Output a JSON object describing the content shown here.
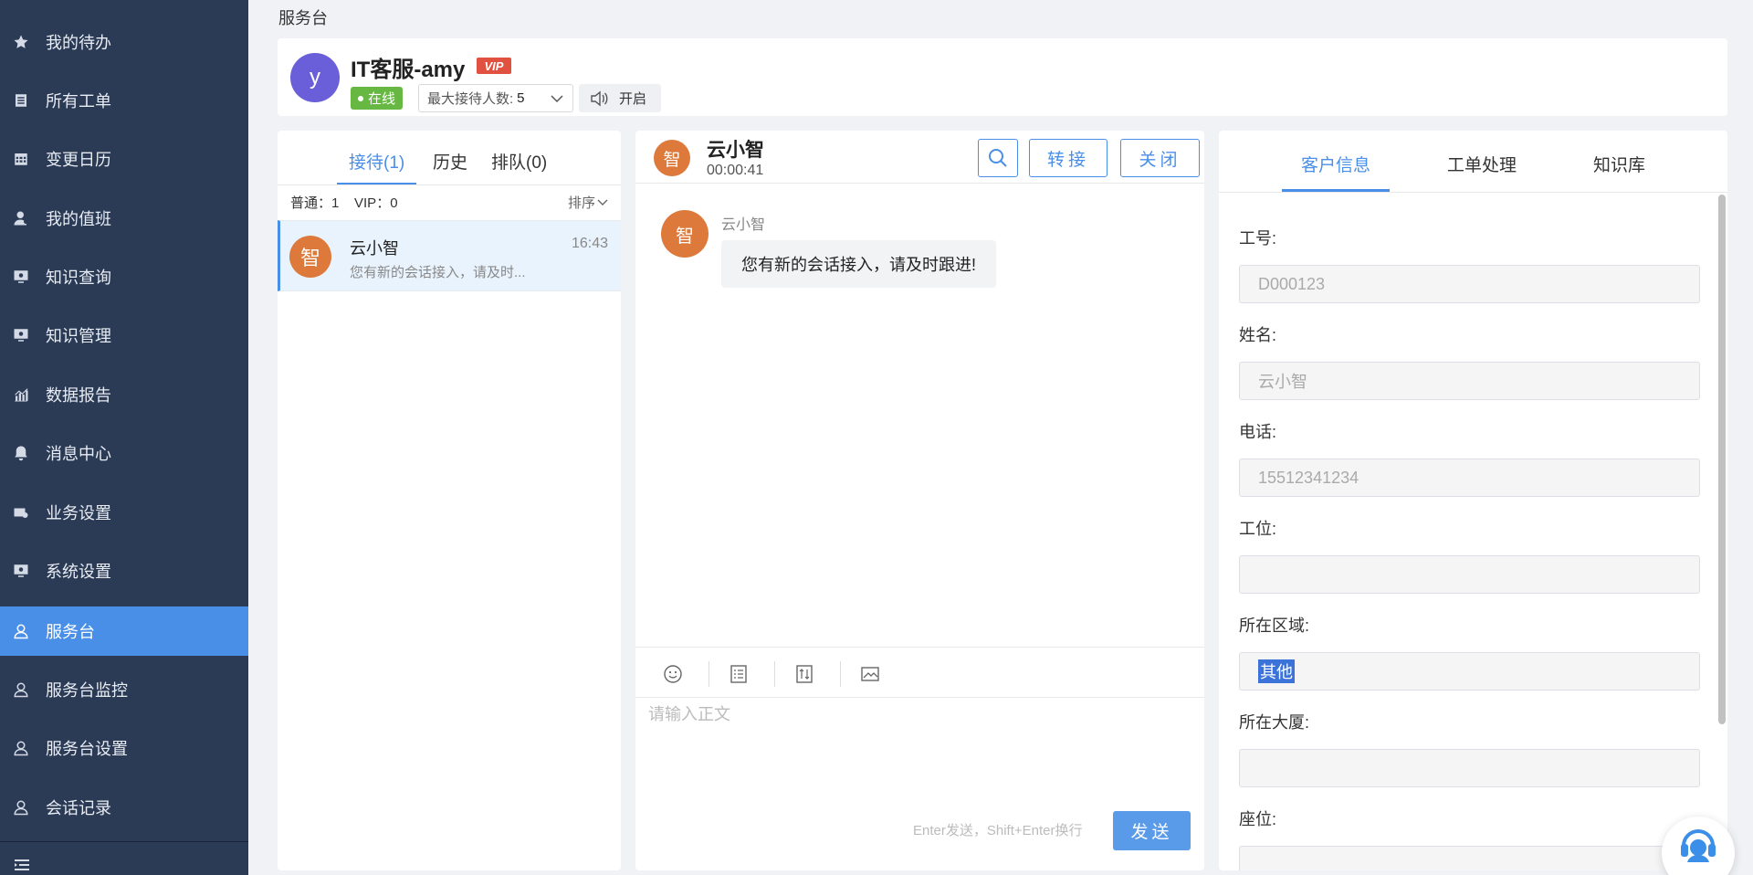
{
  "breadcrumb": "服务台",
  "sidebar": {
    "items": [
      {
        "label": "我的待办",
        "icon": "star-icon"
      },
      {
        "label": "所有工单",
        "icon": "list-icon"
      },
      {
        "label": "变更日历",
        "icon": "calendar-icon"
      },
      {
        "label": "我的值班",
        "icon": "user-icon"
      },
      {
        "label": "知识查询",
        "icon": "monitor-icon"
      },
      {
        "label": "知识管理",
        "icon": "monitor-gear-icon"
      },
      {
        "label": "数据报告",
        "icon": "chart-icon"
      },
      {
        "label": "消息中心",
        "icon": "bell-icon"
      },
      {
        "label": "业务设置",
        "icon": "business-icon"
      },
      {
        "label": "系统设置",
        "icon": "system-icon"
      },
      {
        "label": "服务台",
        "icon": "person-outline-icon"
      },
      {
        "label": "服务台监控",
        "icon": "person-outline-icon"
      },
      {
        "label": "服务台设置",
        "icon": "person-outline-icon"
      },
      {
        "label": "会话记录",
        "icon": "person-outline-icon"
      }
    ],
    "active_index": 10
  },
  "agent": {
    "avatar_letter": "y",
    "name": "IT客服-amy",
    "vip": "VIP",
    "status": "在线",
    "max_label": "最大接待人数:",
    "max_value": "5",
    "sound_label": "开启"
  },
  "session_list": {
    "tabs": [
      "接待(1)",
      "历史",
      "排队(0)"
    ],
    "active_tab": 0,
    "counts": "普通：1    VIP：0",
    "sort_label": "排序",
    "sessions": [
      {
        "avatar": "智",
        "name": "云小智",
        "time": "16:43",
        "preview": "您有新的会话接入，请及时..."
      }
    ]
  },
  "chat": {
    "avatar": "智",
    "name": "云小智",
    "timer": "00:00:41",
    "transfer_label": "转接",
    "close_label": "关闭",
    "messages": [
      {
        "avatar": "智",
        "sender": "云小智",
        "text": "您有新的会话接入，请及时跟进!"
      }
    ],
    "input_placeholder": "请输入正文",
    "send_hint": "Enter发送，Shift+Enter换行",
    "send_label": "发送"
  },
  "info_panel": {
    "tabs": [
      "客户信息",
      "工单处理",
      "知识库"
    ],
    "active_tab": 0,
    "fields": [
      {
        "label": "工号:",
        "value": "D000123"
      },
      {
        "label": "姓名:",
        "value": "云小智"
      },
      {
        "label": "电话:",
        "value": "15512341234"
      },
      {
        "label": "工位:",
        "value": ""
      },
      {
        "label": "所在区域:",
        "value": "其他"
      },
      {
        "label": "所在大厦:",
        "value": ""
      },
      {
        "label": "座位:",
        "value": ""
      }
    ]
  },
  "colors": {
    "sidebar_bg": "#2b3a55",
    "accent": "#4a8fe7",
    "online": "#67b842",
    "avatar_orange": "#dd7a3b",
    "agent_avatar": "#6a5fd8",
    "vip_red": "#e0523f"
  }
}
